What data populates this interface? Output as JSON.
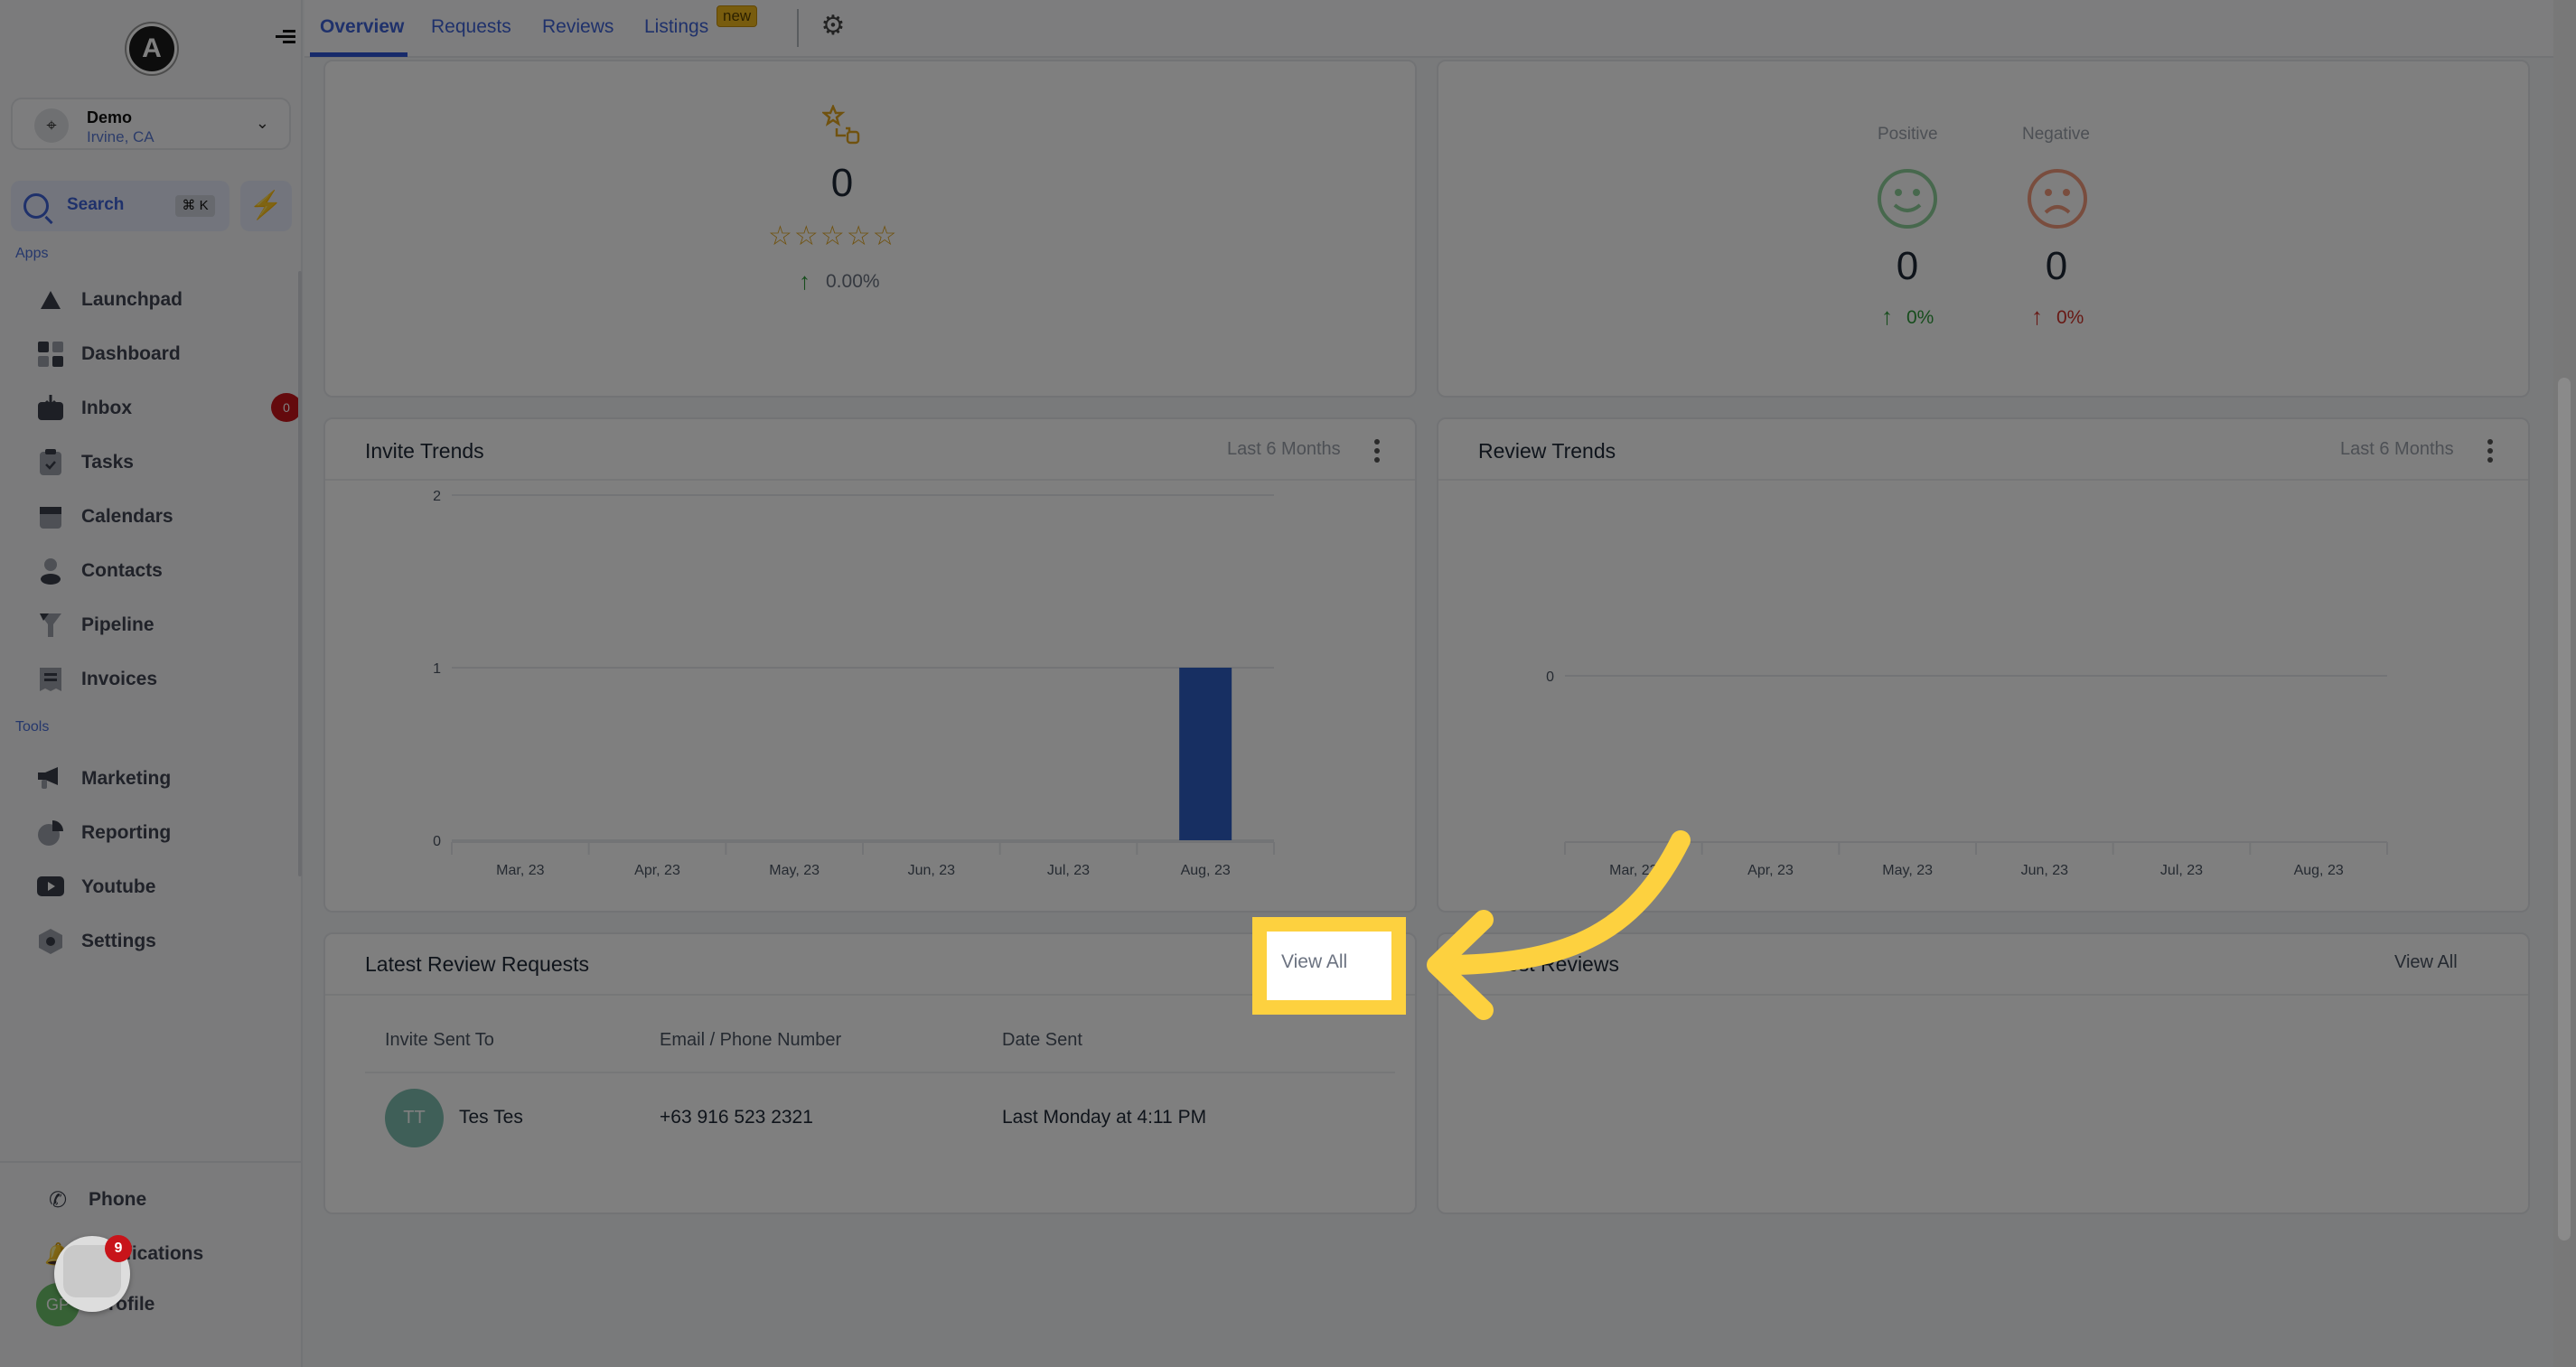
{
  "app": {
    "logo_letter": "A"
  },
  "location": {
    "name": "Demo",
    "city": "Irvine, CA"
  },
  "search": {
    "label": "Search",
    "shortcut": "⌘ K"
  },
  "sidebar": {
    "apps_title": "Apps",
    "tools_title": "Tools",
    "apps": [
      {
        "label": "Launchpad",
        "icon": "rocket-icon"
      },
      {
        "label": "Dashboard",
        "icon": "grid-icon"
      },
      {
        "label": "Inbox",
        "icon": "inbox-icon",
        "badge": "0"
      },
      {
        "label": "Tasks",
        "icon": "clipboard-check-icon"
      },
      {
        "label": "Calendars",
        "icon": "calendar-icon"
      },
      {
        "label": "Contacts",
        "icon": "person-icon"
      },
      {
        "label": "Pipeline",
        "icon": "funnel-icon"
      },
      {
        "label": "Invoices",
        "icon": "receipt-icon"
      }
    ],
    "tools": [
      {
        "label": "Marketing",
        "icon": "megaphone-icon"
      },
      {
        "label": "Reporting",
        "icon": "pie-chart-icon"
      },
      {
        "label": "Youtube",
        "icon": "youtube-icon"
      },
      {
        "label": "Settings",
        "icon": "settings-hex-icon"
      }
    ],
    "bottom": [
      {
        "label": "Phone",
        "icon": "phone-icon"
      },
      {
        "label": "Notifications",
        "icon": "bell-icon"
      },
      {
        "label": "Profile",
        "icon": "avatar-icon",
        "initials": "GP"
      }
    ],
    "chat_badge": "9"
  },
  "tabs": [
    {
      "label": "Overview",
      "active": true
    },
    {
      "label": "Requests"
    },
    {
      "label": "Reviews"
    },
    {
      "label": "Listings",
      "badge": "new"
    }
  ],
  "rating_card": {
    "value": "0",
    "stars": 0,
    "max_stars": 5,
    "change": "0.00%",
    "change_direction": "up"
  },
  "sentiment_card": {
    "positive": {
      "label": "Positive",
      "value": "0",
      "change": "0%"
    },
    "negative": {
      "label": "Negative",
      "value": "0",
      "change": "0%"
    }
  },
  "invite_trends": {
    "title": "Invite Trends",
    "range": "Last 6 Months"
  },
  "review_trends": {
    "title": "Review Trends",
    "range": "Last 6 Months"
  },
  "latest_requests": {
    "title": "Latest Review Requests",
    "view_all": "View All",
    "columns": [
      "Invite Sent To",
      "Email / Phone Number",
      "Date Sent"
    ],
    "rows": [
      {
        "initials": "TT",
        "name": "Tes Tes",
        "contact": "+63 916 523 2321",
        "date": "Last Monday at 4:11 PM"
      }
    ]
  },
  "latest_reviews": {
    "title": "Latest Reviews",
    "view_all": "View All"
  },
  "colors": {
    "accent": "#3f63d6",
    "bar": "#2f5fc4",
    "highlight": "#fdd13f",
    "positive": "#2e9b3a",
    "negative": "#d0322a",
    "star": "#e1a51f"
  },
  "chart_data": [
    {
      "type": "bar",
      "title": "Invite Trends",
      "categories": [
        "Mar, 23",
        "Apr, 23",
        "May, 23",
        "Jun, 23",
        "Jul, 23",
        "Aug, 23"
      ],
      "values": [
        0,
        0,
        0,
        0,
        0,
        1
      ],
      "yticks": [
        "0",
        "1",
        "2"
      ],
      "ylim": [
        0,
        2
      ],
      "xlabel": "",
      "ylabel": "",
      "grid": true
    },
    {
      "type": "bar",
      "title": "Review Trends",
      "categories": [
        "Mar, 23",
        "Apr, 23",
        "May, 23",
        "Jun, 23",
        "Jul, 23",
        "Aug, 23"
      ],
      "values": [
        0,
        0,
        0,
        0,
        0,
        0
      ],
      "yticks": [
        "0"
      ],
      "ylim": [
        0,
        0
      ],
      "xlabel": "",
      "ylabel": "",
      "grid": true
    }
  ]
}
